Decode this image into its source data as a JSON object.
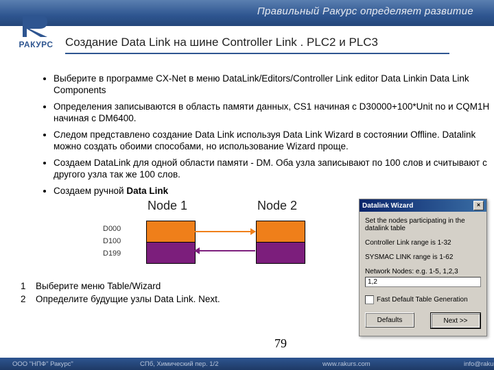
{
  "banner": {
    "slogan": "Правильный Ракурс определяет развитие"
  },
  "logo": {
    "text": "РАКУРС"
  },
  "title": "Создание Data Link на шине Controller Link . PLC2 и PLC3",
  "bullets": [
    "Выберите в программе CX-Net в меню DataLink/Editors/Controller Link editor Data Linkin Data Link Components",
    "Определения записываются в область памяти данных, CS1 начиная с D30000+100*Unit no и CQM1H начиная с DM6400.",
    "Следом представлено создание Data Link используя Data Link Wizard в состоянии Offline. Datalink можно создать обоими способами, но использование Wizard проще.",
    "Создаем DataLink для одной области памяти - DM. Оба узла записывают по 100 слов и считывают с другого узла так же 100 слов.",
    "Создаем ручной Data Link"
  ],
  "diagram": {
    "node1": "Node 1",
    "node2": "Node 2",
    "d0": "D000",
    "d1": "D100",
    "d2": "D199"
  },
  "steps": [
    {
      "n": "1",
      "t": "Выберите меню Table/Wizard"
    },
    {
      "n": "2",
      "t": "Определите будущие узлы Data Link. Next."
    }
  ],
  "dialog": {
    "title": "Datalink Wizard",
    "line1": "Set the nodes participating in the datalink table",
    "line2": "Controller Link range is 1-32",
    "line3": "SYSMAC LINK range is 1-62",
    "nodes_label": "Network Nodes: e.g. 1-5, 1,2,3",
    "nodes_value": "1,2",
    "check": "Fast Default Table Generation",
    "defaults": "Defaults",
    "next": "Next >>"
  },
  "page": "79",
  "footer": {
    "org": "ООО \"НПФ\" Ракурс\"",
    "addr": "СПб, Химический пер. 1/2",
    "site": "www.rakurs.com",
    "mail": "info@rakurs."
  }
}
